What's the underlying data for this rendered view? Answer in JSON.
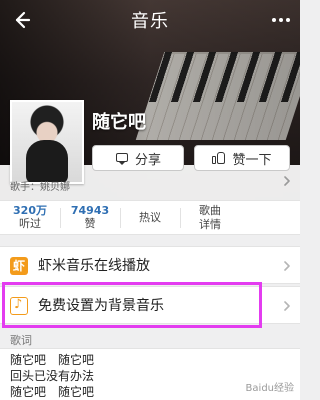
{
  "header": {
    "title": "音乐"
  },
  "song": {
    "title": "随它吧"
  },
  "actions": {
    "share_label": "分享",
    "like_label": "赞一下"
  },
  "singer": {
    "label": "歌手：姚贝娜"
  },
  "stats": {
    "listens_value": "320万",
    "listens_label": "听过",
    "likes_value": "74943",
    "likes_label": "赞",
    "discuss_label": "热议",
    "details_label_line1": "歌曲",
    "details_label_line2": "详情"
  },
  "rows": {
    "xiami_label": "虾米音乐在线播放",
    "xiami_icon_text": "虾",
    "bg_music_label": "免费设置为背景音乐"
  },
  "lyrics": {
    "label": "歌词",
    "lines": [
      "随它吧　随它吧",
      "回头已没有办法",
      "随它吧　随它吧"
    ]
  },
  "watermark": {
    "text": "Baidu经验"
  },
  "colors": {
    "highlight": "#e33cf0",
    "accent": "#f39b1b",
    "stat_blue": "#2f6fb3"
  },
  "icons": {
    "back": "back-arrow-icon",
    "more": "more-dots-icon",
    "share": "share-icon",
    "like": "thumbs-up-icon",
    "chevron": "chevron-right-icon",
    "xiami": "xiami-icon",
    "background_music": "music-note-icon"
  }
}
